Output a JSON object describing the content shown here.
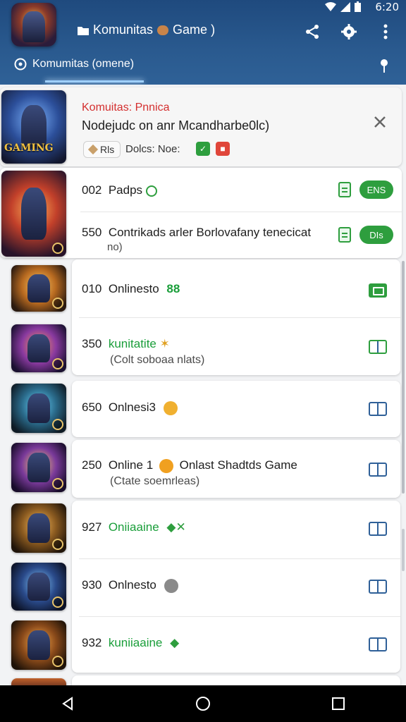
{
  "status": {
    "time": "6:20"
  },
  "appbar": {
    "title": "Komunitas",
    "title_suffix": "Game )"
  },
  "tab": {
    "label": "Komumitas (omene)"
  },
  "featured": {
    "heading": "Komuitas: Pnnica",
    "title": "Nodejudc on anr Mcandharbe0lc)",
    "chip_label": "Rls",
    "meta_label": "Dolcs: Noe:",
    "thumb_text": "GAMING"
  },
  "rows": [
    {
      "num": "002",
      "name": "Padps",
      "pill": "ENS",
      "accent": "green"
    },
    {
      "num": "550",
      "name": "Contrikads arler Borlovafany tenecicat",
      "sub": "no)",
      "pill": "DIs"
    },
    {
      "num": "010",
      "name": "Onlinesto",
      "tag": "88"
    },
    {
      "num": "350",
      "name": "kunitatite",
      "sub": "(Colt soboaa nlats)"
    },
    {
      "num": "650",
      "name": "Onlnesi3"
    },
    {
      "num": "250",
      "name": "Online 1",
      "extra": "Onlast Shadtds Game",
      "sub": "(Ctate soemrleas)"
    },
    {
      "num": "927",
      "name": "Oniiaaine"
    },
    {
      "num": "930",
      "name": "Onlnesto"
    },
    {
      "num": "932",
      "name": "kuniiaaine"
    }
  ]
}
